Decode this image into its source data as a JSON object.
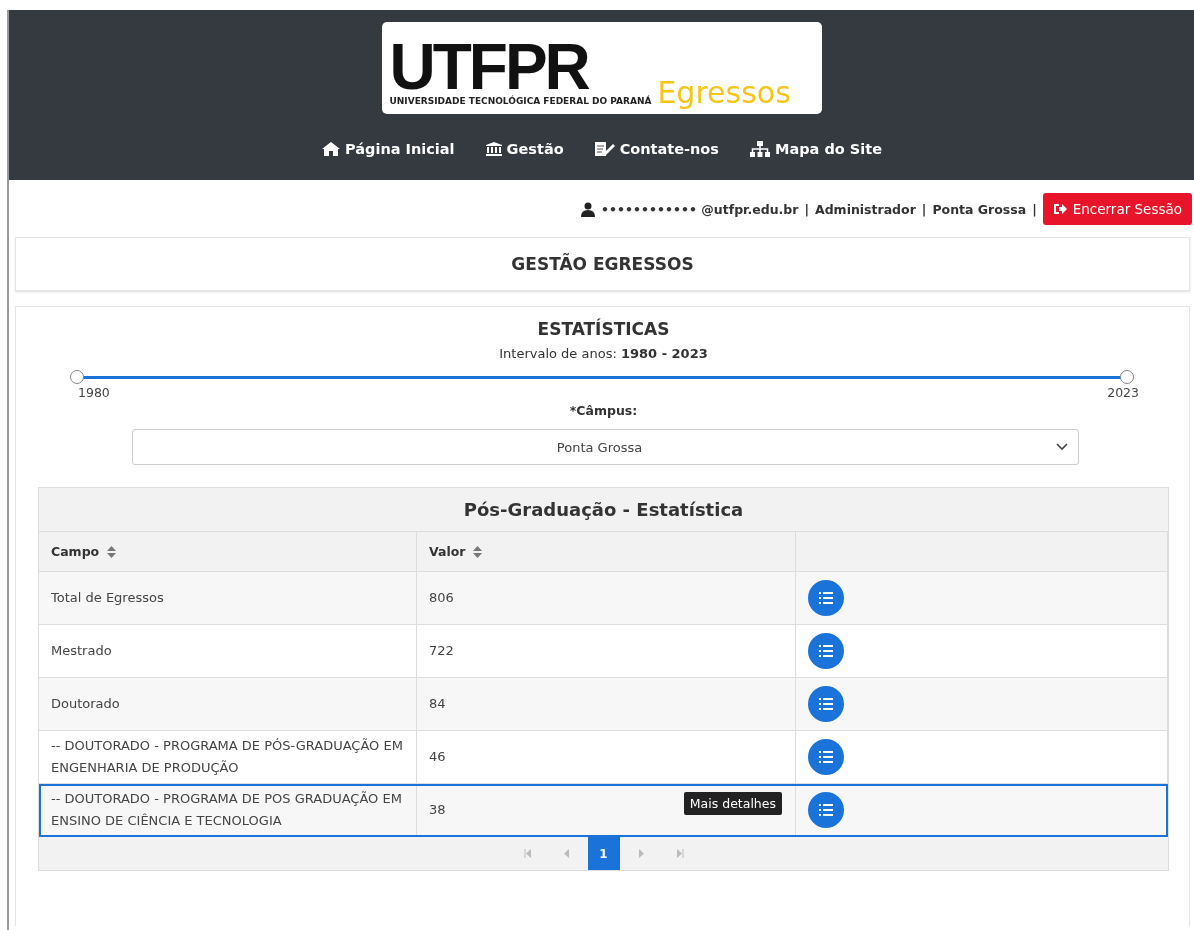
{
  "logo": {
    "wordmark": "UTFPR",
    "subtitle": "UNIVERSIDADE TECNOLÓGICA FEDERAL DO PARANÁ",
    "product": "Egressos"
  },
  "nav": [
    {
      "label": "Página Inicial"
    },
    {
      "label": "Gestão"
    },
    {
      "label": "Contate-nos"
    },
    {
      "label": "Mapa do Site"
    }
  ],
  "user_bar": {
    "email": "•••••••••••• @utfpr.edu.br",
    "role": "Administrador",
    "campus": "Ponta Grossa",
    "separator": "|",
    "logout": "Encerrar Sessão"
  },
  "page_title": "GESTÃO EGRESSOS",
  "stats": {
    "title": "ESTATÍSTICAS",
    "interval_label": "Intervalo de anos:",
    "interval_value": "1980 - 2023",
    "slider": {
      "level": 1,
      "min_label": "1980",
      "max_label": "2023"
    },
    "campus_label": "*Câmpus:",
    "campus_value": "Ponta Grossa"
  },
  "table": {
    "title": "Pós-Graduação - Estatística",
    "columns": [
      "Campo",
      "Valor"
    ],
    "rows": [
      {
        "campo": "Total de Egressos",
        "valor": "806",
        "selected": false
      },
      {
        "campo": "Mestrado",
        "valor": "722",
        "selected": false
      },
      {
        "campo": "Doutorado",
        "valor": "84",
        "selected": false
      },
      {
        "campo": "-- DOUTORADO - PROGRAMA DE PÓS-GRADUAÇÃO EM ENGENHARIA DE PRODUÇÃO",
        "valor": "46",
        "selected": false
      },
      {
        "campo": "-- DOUTORADO - PROGRAMA DE POS GRADUAÇÃO EM ENSINO DE CIÊNCIA E TECNOLOGIA",
        "valor": "38",
        "selected": true,
        "tooltip": "Mais detalhes"
      }
    ],
    "pagination": {
      "pages": [
        {
          "label": "1",
          "selected": true
        }
      ]
    }
  }
}
